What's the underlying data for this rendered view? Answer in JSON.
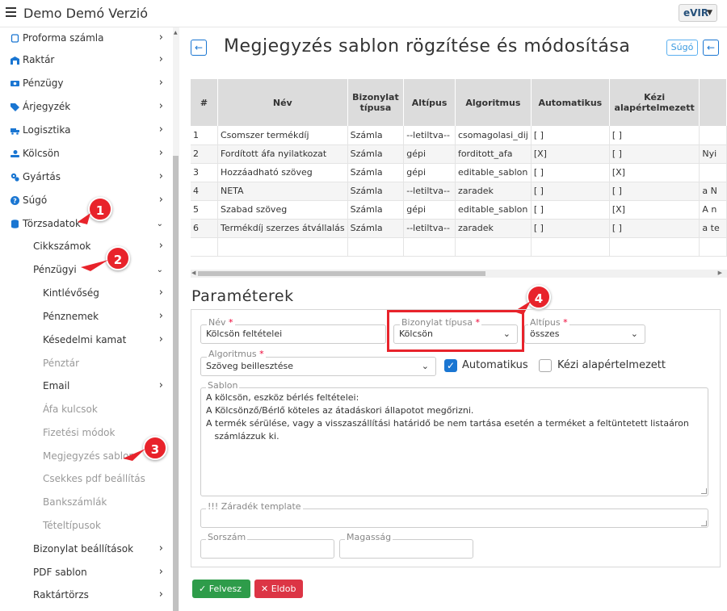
{
  "app": {
    "title": "Demo Demó Verzió",
    "logo_text": "eVIR"
  },
  "sidebar": {
    "items": [
      {
        "label": "Proforma számla",
        "icon": "document-icon"
      },
      {
        "label": "Raktár",
        "icon": "warehouse-icon"
      },
      {
        "label": "Pénzügy",
        "icon": "money-icon"
      },
      {
        "label": "Árjegyzék",
        "icon": "tag-icon"
      },
      {
        "label": "Logisztika",
        "icon": "truck-icon"
      },
      {
        "label": "Kölcsön",
        "icon": "hand-icon"
      },
      {
        "label": "Gyártás",
        "icon": "gears-icon"
      },
      {
        "label": "Súgó",
        "icon": "question-icon"
      },
      {
        "label": "Törzsadatok",
        "icon": "database-icon"
      },
      {
        "label": "Cikkszámok"
      },
      {
        "label": "Pénzügyi"
      },
      {
        "label": "Kintlévőség"
      },
      {
        "label": "Pénznemek"
      },
      {
        "label": "Késedelmi kamat"
      },
      {
        "label": "Pénztár"
      },
      {
        "label": "Email"
      },
      {
        "label": "Áfa kulcsok"
      },
      {
        "label": "Fizetési módok"
      },
      {
        "label": "Megjegyzés sablon"
      },
      {
        "label": "Csekkes pdf beállítás"
      },
      {
        "label": "Bankszámlák"
      },
      {
        "label": "Tételtípusok"
      },
      {
        "label": "Bizonylat beállítások"
      },
      {
        "label": "PDF sablon"
      },
      {
        "label": "Raktártörzs"
      }
    ]
  },
  "callouts": [
    "1",
    "2",
    "3",
    "4"
  ],
  "page": {
    "title": "Megjegyzés sablon rögzítése és módosítása",
    "help_label": "Súgó"
  },
  "table": {
    "headers": [
      "#",
      "Név",
      "Bizonylat típusa",
      "Altípus",
      "Algoritmus",
      "Automatikus",
      "Kézi alapértelmezett",
      ""
    ],
    "rows": [
      [
        "1",
        "Csomszer termékdíj",
        "Számla",
        "--letiltva--",
        "csomagolasi_dij",
        "[ ]",
        "[ ]",
        ""
      ],
      [
        "2",
        "Fordított áfa nyilatkozat",
        "Számla",
        "gépi",
        "forditott_afa",
        "[X]",
        "[ ]",
        "Nyi"
      ],
      [
        "3",
        "Hozzáadható szöveg",
        "Számla",
        "gépi",
        "editable_sablon",
        "[ ]",
        "[X]",
        ""
      ],
      [
        "4",
        "NETA",
        "Számla",
        "--letiltva--",
        "zaradek",
        "[ ]",
        "[ ]",
        "a N"
      ],
      [
        "5",
        "Szabad szöveg",
        "Számla",
        "gépi",
        "editable_sablon",
        "[ ]",
        "[X]",
        "A n"
      ],
      [
        "6",
        "Termékdíj szerzes átvállalás",
        "Számla",
        "--letiltva--",
        "zaradek",
        "[ ]",
        "[ ]",
        "a te"
      ]
    ]
  },
  "params": {
    "title": "Paraméterek",
    "name": {
      "label": "Név",
      "value": "Kölcsön feltételei"
    },
    "doc_type": {
      "label": "Bizonylat típusa",
      "value": "Kölcsön"
    },
    "subtype": {
      "label": "Altípus",
      "value": "összes"
    },
    "algorithm": {
      "label": "Algoritmus",
      "value": "Szöveg beillesztése"
    },
    "automatic": {
      "label": "Automatikus",
      "checked": true
    },
    "manual_default": {
      "label": "Kézi alapértelmezett",
      "checked": false
    },
    "template": {
      "label": "Sablon",
      "value": "A kölcsön, eszköz bérlés feltételei:\nA Kölcsönző/Bérlő köteles az átadáskori állapotot megőrizni.\nA termék sérülése, vagy a visszaszállítási határidő be nem tartása esetén a terméket a feltüntetett listaáron\n   számlázzuk ki."
    },
    "clause_template": {
      "label": "!!! Záradék template",
      "value": ""
    },
    "serial": {
      "label": "Sorszám",
      "value": ""
    },
    "height": {
      "label": "Magasság",
      "value": ""
    }
  },
  "actions": {
    "save_label": "Felvesz",
    "discard_label": "Eldob"
  }
}
